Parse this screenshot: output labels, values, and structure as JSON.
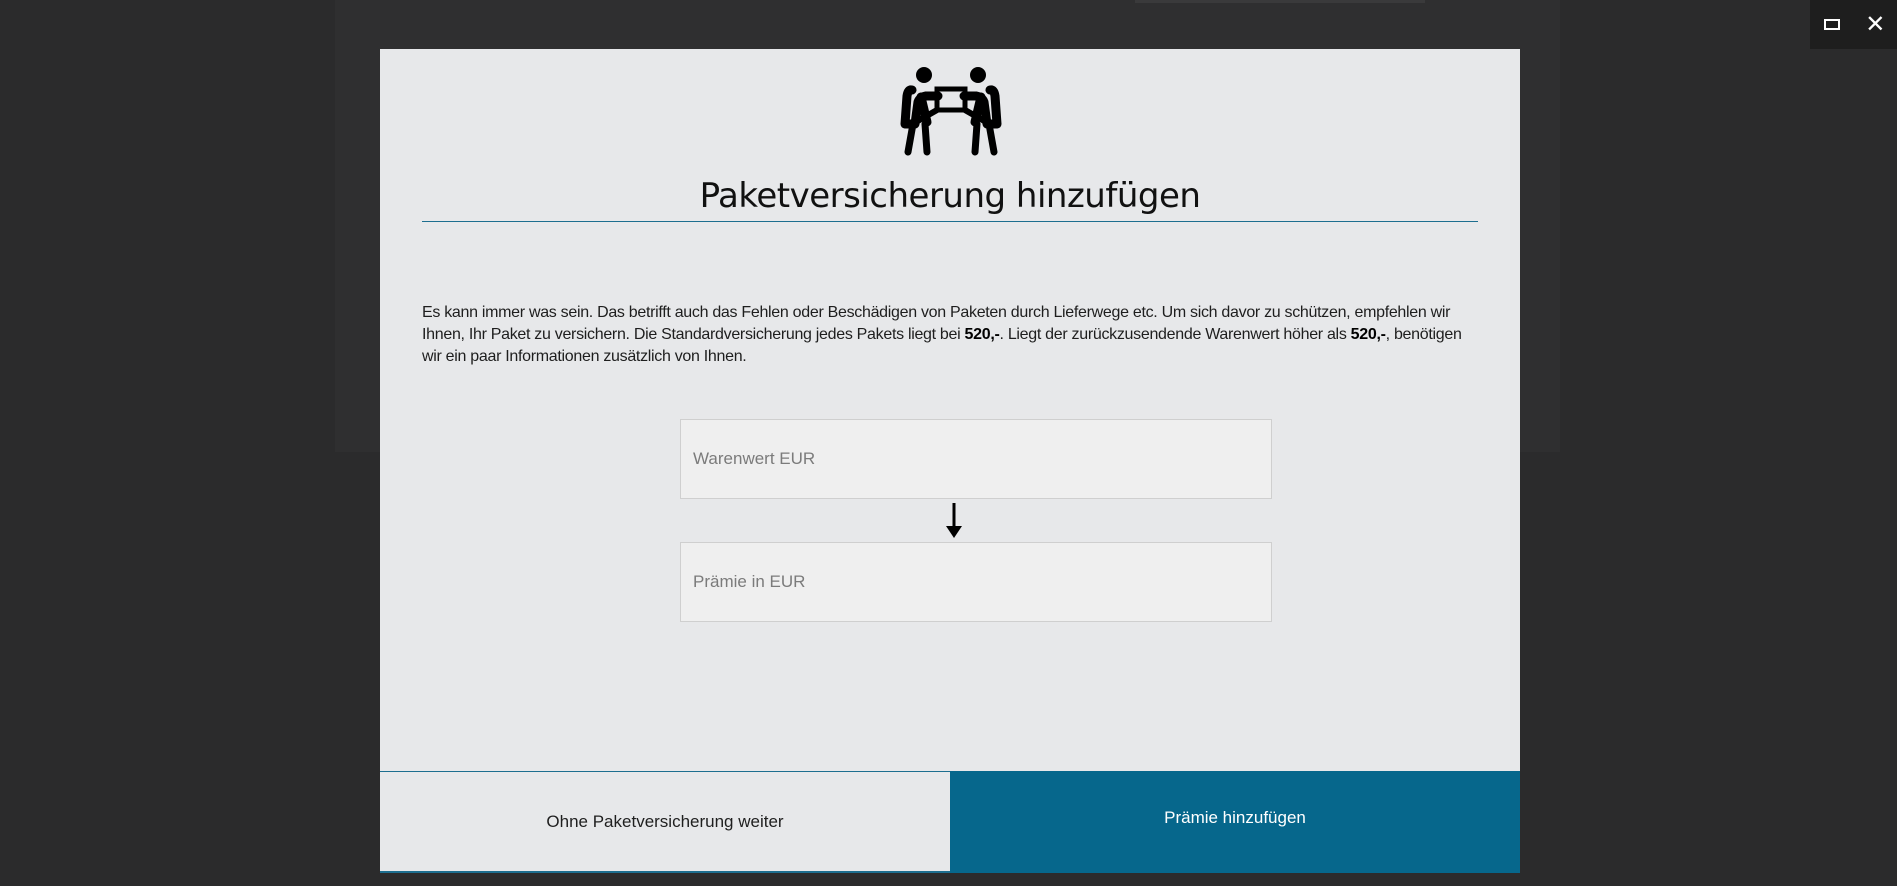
{
  "window_controls": {
    "maximize_icon": "maximize-icon",
    "close_icon": "close-icon",
    "close_glyph": "✕"
  },
  "modal": {
    "icon": "people-carrying-box-icon",
    "title": "Paketversicherung hinzufügen",
    "description": {
      "part1": "Es kann immer was sein. Das betrifft auch das Fehlen oder Beschädigen von Paketen durch Lieferwege etc. Um sich davor zu schützen, empfehlen wir Ihnen, Ihr Paket zu versichern. Die Standardversicherung jedes Pakets liegt bei ",
      "amount1": "520,-",
      "part2": ". Liegt der zurückzusendende Warenwert höher als ",
      "amount2": "520,-",
      "part3": ", benötigen wir ein paar Informationen zusätzlich von Ihnen."
    },
    "fields": {
      "goods_value": {
        "placeholder": "Warenwert EUR",
        "value": ""
      },
      "premium": {
        "placeholder": "Prämie in EUR",
        "value": ""
      }
    },
    "arrow_icon": "arrow-down-icon",
    "buttons": {
      "skip_label": "Ohne Paketversicherung weiter",
      "add_label": "Prämie hinzufügen"
    }
  },
  "colors": {
    "accent": "#06678c",
    "modal_bg": "#e7e8ea",
    "backdrop": "#2b2b2c"
  }
}
